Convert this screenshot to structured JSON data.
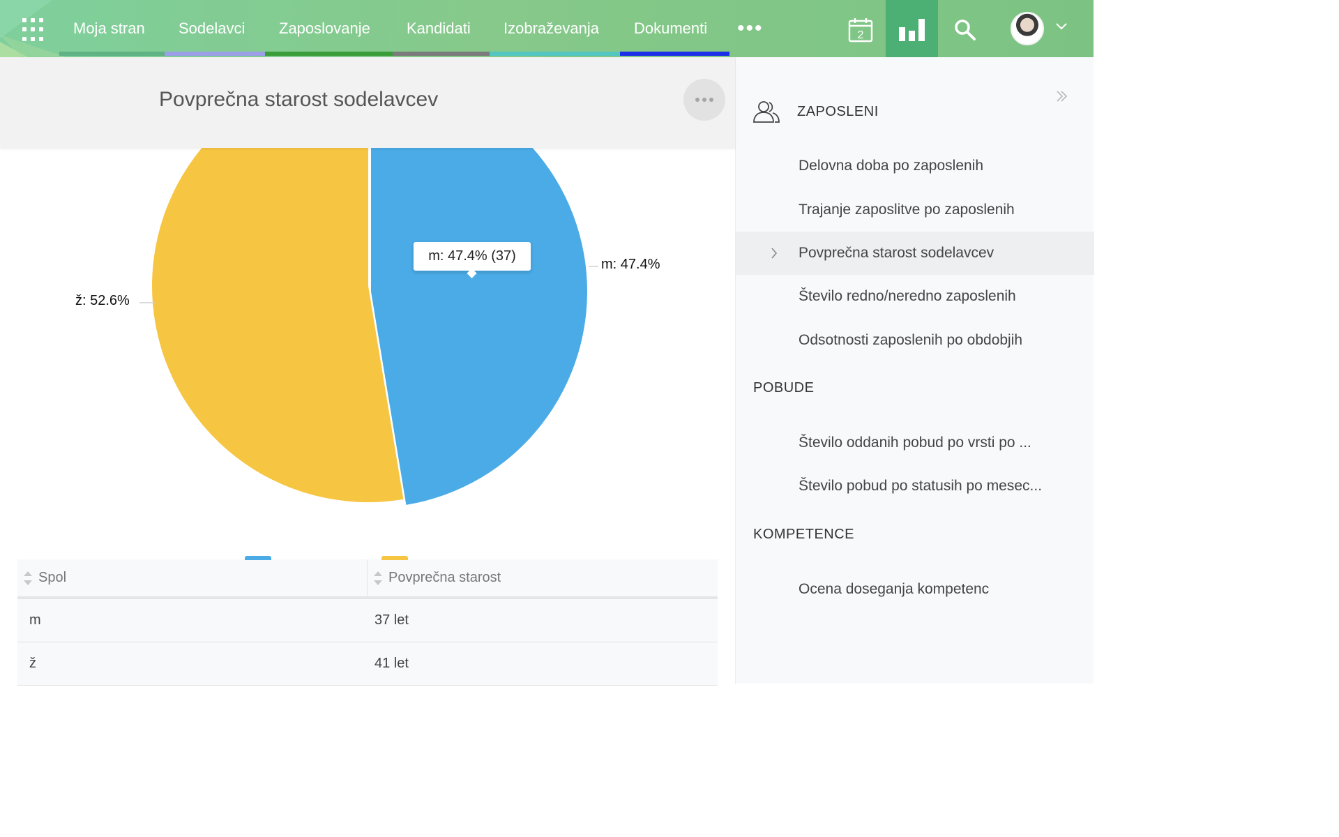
{
  "nav": {
    "items": [
      {
        "label": "Moja stran",
        "color": "#5eb283"
      },
      {
        "label": "Sodelavci",
        "color": "#9a9fe6"
      },
      {
        "label": "Zaposlovanje",
        "color": "#3a9d3a"
      },
      {
        "label": "Kandidati",
        "color": "#7b7b7b"
      },
      {
        "label": "Izobraževanja",
        "color": "#53c6c1"
      },
      {
        "label": "Dokumenti",
        "color": "#1b2ee8"
      }
    ],
    "more": "•••",
    "calendar_day": "2"
  },
  "panel": {
    "title": "Povprečna starost sodelavcev"
  },
  "chart_data": {
    "type": "pie",
    "slices": [
      {
        "label": "m",
        "percent": 47.4,
        "value": 37,
        "color": "#4aabe7"
      },
      {
        "label": "ž",
        "percent": 52.6,
        "value": 41,
        "color": "#f6c542"
      }
    ],
    "labels": {
      "m": "m: 47.4%",
      "z": "ž: 52.6%"
    },
    "tooltip": "m: 47.4% (37)",
    "legend_colors": [
      "#4aabe7",
      "#f6c542"
    ]
  },
  "table": {
    "headers": [
      "Spol",
      "Povprečna starost"
    ],
    "rows": [
      [
        "m",
        "37 let"
      ],
      [
        "ž",
        "41 let"
      ]
    ]
  },
  "sidebar": {
    "sections": [
      {
        "title": "ZAPOSLENI"
      },
      {
        "title": "POBUDE"
      },
      {
        "title": "KOMPETENCE"
      }
    ],
    "items": [
      "Delovna doba po zaposlenih",
      "Trajanje zaposlitve po zaposlenih",
      "Povprečna starost sodelavcev",
      "Število redno/neredno zaposlenih",
      "Odsotnosti zaposlenih po obdobjih",
      "Število oddanih pobud po vrsti po ...",
      "Število pobud po statusih po mesec...",
      "Ocena doseganja kompetenc"
    ],
    "active_index": 2
  }
}
